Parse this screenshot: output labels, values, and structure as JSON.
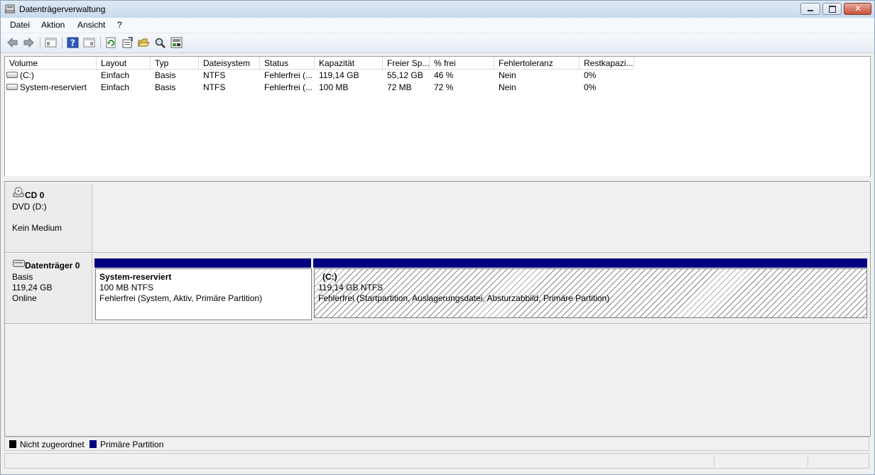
{
  "window": {
    "title": "Datenträgerverwaltung"
  },
  "menu": [
    "Datei",
    "Aktion",
    "Ansicht",
    "?"
  ],
  "toolbar": {
    "icons": [
      "back-icon",
      "forward-icon",
      "console-tree-icon",
      "help-icon",
      "properties-view-icon",
      "refresh-icon",
      "properties-icon",
      "open-icon",
      "search-icon",
      "rescan-icon"
    ]
  },
  "volume_list": {
    "columns": [
      "Volume",
      "Layout",
      "Typ",
      "Dateisystem",
      "Status",
      "Kapazität",
      "Freier Sp...",
      "% frei",
      "Fehlertoleranz",
      "Restkapazi..."
    ],
    "rows": [
      [
        "(C:)",
        "Einfach",
        "Basis",
        "NTFS",
        "Fehlerfrei (...",
        "119,14 GB",
        "55,12 GB",
        "46 %",
        "Nein",
        "0%"
      ],
      [
        "System-reserviert",
        "Einfach",
        "Basis",
        "NTFS",
        "Fehlerfrei (...",
        "100 MB",
        "72 MB",
        "72 %",
        "Nein",
        "0%"
      ]
    ]
  },
  "disks": {
    "cd0": {
      "name": "CD 0",
      "line1": "DVD (D:)",
      "line2": "Kein Medium"
    },
    "disk0": {
      "name": "Datenträger 0",
      "type": "Basis",
      "size": "119,24 GB",
      "state": "Online",
      "partitions": [
        {
          "title": "System-reserviert",
          "size_fs": "100 MB NTFS",
          "status": "Fehlerfrei (System, Aktiv, Primäre Partition)"
        },
        {
          "title": "(C:)",
          "size_fs": "119,14 GB NTFS",
          "status": "Fehlerfrei (Startpartition, Auslagerungsdatei, Absturzabbild, Primäre Partition)"
        }
      ]
    }
  },
  "legend": [
    {
      "label": "Nicht zugeordnet",
      "color": "#000000"
    },
    {
      "label": "Primäre Partition",
      "color": "#000080"
    }
  ],
  "colors": {
    "partition_bar": "#000080",
    "title_bar": "#dfe9f5"
  }
}
